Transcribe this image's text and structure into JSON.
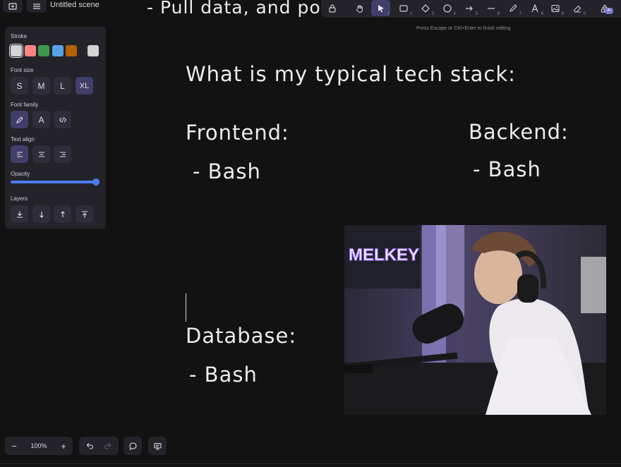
{
  "header": {
    "scene_title": "Untitled scene"
  },
  "toolbar": {
    "tools": [
      {
        "icon": "lock-icon",
        "num": ""
      },
      {
        "icon": "hand-icon",
        "num": ""
      },
      {
        "icon": "selection-arrow-icon",
        "num": "1"
      },
      {
        "icon": "rectangle-icon",
        "num": "2"
      },
      {
        "icon": "diamond-icon",
        "num": "3"
      },
      {
        "icon": "ellipse-icon",
        "num": "4"
      },
      {
        "icon": "arrow-icon",
        "num": "5"
      },
      {
        "icon": "line-icon",
        "num": "6"
      },
      {
        "icon": "draw-icon",
        "num": "7"
      },
      {
        "icon": "text-icon",
        "num": "8"
      },
      {
        "icon": "image-icon",
        "num": "9"
      },
      {
        "icon": "eraser-icon",
        "num": "0"
      },
      {
        "icon": "more-tools-icon",
        "num": ""
      }
    ],
    "ai_badge": "AI",
    "hint": "Press Escape or Ctrl+Enter to finish editing"
  },
  "panel": {
    "stroke_label": "Stroke",
    "stroke_colors": [
      "#d4d4d4",
      "#ff8383",
      "#3a994c",
      "#56a2e8",
      "#b76100"
    ],
    "current_stroke": "#d4d4d4",
    "font_size_label": "Font size",
    "font_sizes": [
      "S",
      "M",
      "L",
      "XL"
    ],
    "font_size_selected": "XL",
    "font_family_label": "Font family",
    "font_family_letter": "A",
    "text_align_label": "Text align",
    "opacity_label": "Opacity",
    "opacity_value": 1.0,
    "layers_label": "Layers"
  },
  "canvas": {
    "top_partial": "- Pull data, and po",
    "heading": "What is my typical tech stack:",
    "frontend_label": "Frontend:",
    "frontend_item": "- Bash",
    "backend_label": "Backend:",
    "backend_item": "- Bash",
    "database_label": "Database:",
    "database_item": "- Bash",
    "webcam_sign": "MELKEY"
  },
  "footer": {
    "zoom_out": "−",
    "zoom_level": "100%",
    "zoom_in": "+"
  }
}
